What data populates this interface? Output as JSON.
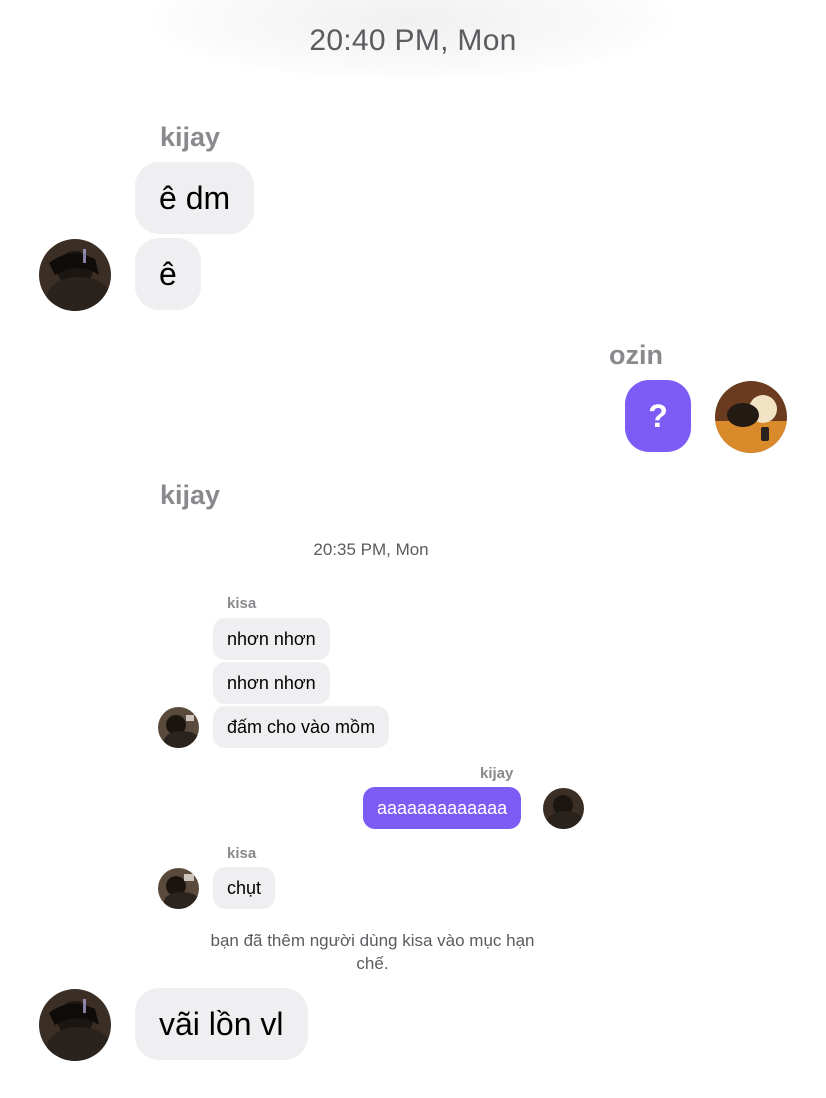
{
  "outer": {
    "timestamp": "20:40 PM, Mon",
    "messages": [
      {
        "sender": "kijay",
        "bubbles": [
          "ê dm",
          "ê"
        ]
      },
      {
        "sender": "ozin",
        "bubbles": [
          "?"
        ]
      },
      {
        "sender": "kijay",
        "bubbles": [
          "vãi lồn vl"
        ]
      }
    ]
  },
  "screenshot": {
    "timestamp": "20:35 PM, Mon",
    "group1": {
      "sender": "kisa",
      "bubbles": [
        "nhơn nhơn",
        "nhơn nhơn",
        "đấm cho vào mồm"
      ]
    },
    "group2": {
      "sender": "kijay",
      "bubbles": [
        "aaaaaaaaaaaaa"
      ]
    },
    "group3": {
      "sender": "kisa",
      "bubbles": [
        "chụt"
      ]
    },
    "notice": "bạn đã thêm người dùng kisa vào mục hạn chế."
  },
  "colors": {
    "accent": "#7d5cf6",
    "bubble_gray": "#efeff2",
    "meta_text": "#8a8a8e"
  }
}
